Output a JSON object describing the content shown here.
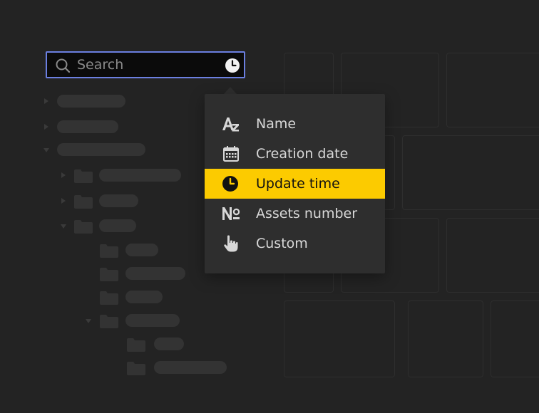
{
  "search": {
    "placeholder": "Search",
    "sort_icon": "clock-icon"
  },
  "sort_menu": {
    "items": [
      {
        "label": "Name",
        "icon": "alphabetical-sort-icon",
        "selected": false
      },
      {
        "label": "Creation date",
        "icon": "calendar-icon",
        "selected": false
      },
      {
        "label": "Update time",
        "icon": "clock-icon",
        "selected": true
      },
      {
        "label": "Assets number",
        "icon": "numero-sign-icon",
        "selected": false
      },
      {
        "label": "Custom",
        "icon": "hand-pointer-icon",
        "selected": false
      }
    ]
  },
  "colors": {
    "background": "#232323",
    "menu_background": "#2e2e2e",
    "selected_highlight": "#fccb00",
    "search_border": "#6b7fe0",
    "search_field": "#0b0b0b",
    "menu_text": "#d8d8d8",
    "selected_text": "#111111",
    "skeleton": "#333333"
  }
}
